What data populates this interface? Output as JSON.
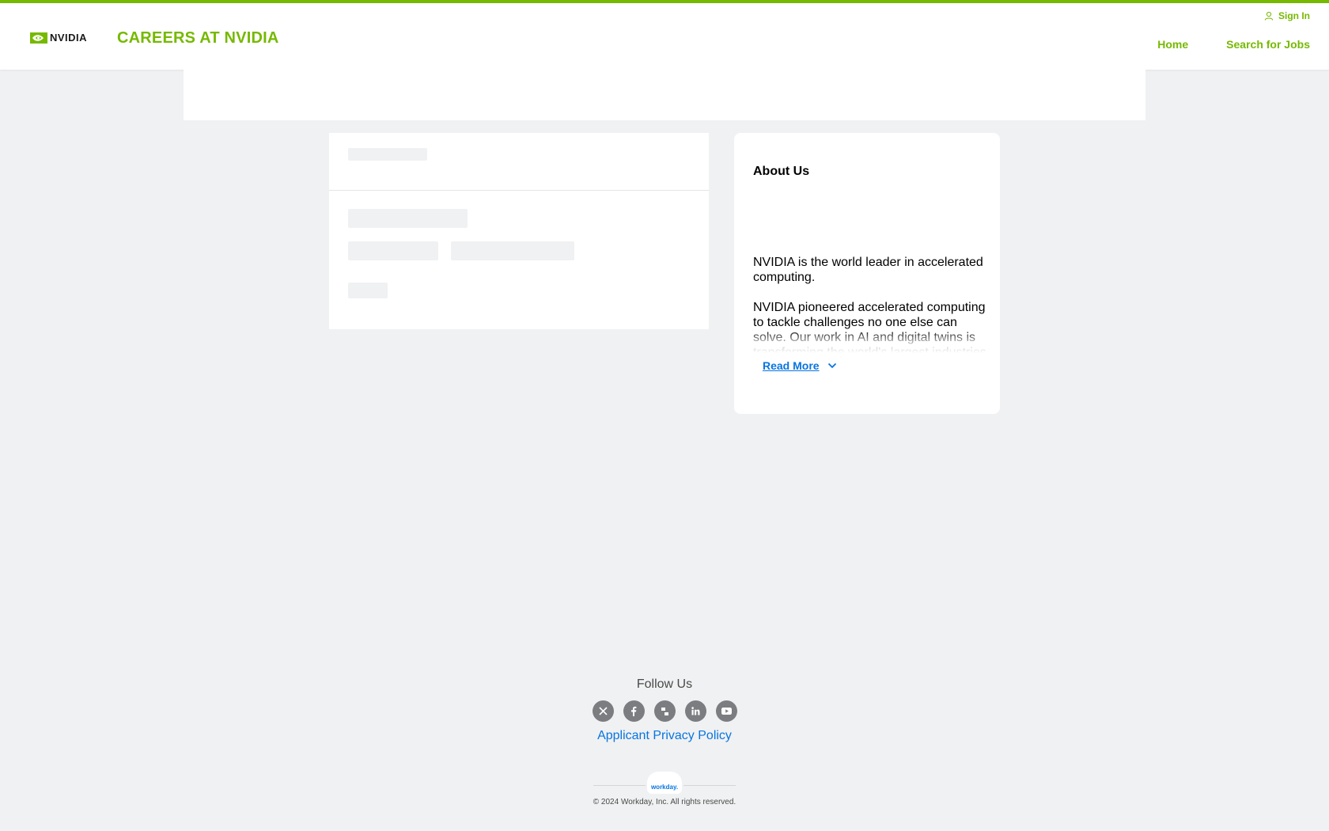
{
  "header": {
    "logo_text": "NVIDIA",
    "site_title": "CAREERS AT NVIDIA",
    "sign_in": "Sign In",
    "nav": [
      "Home",
      "Search for Jobs"
    ],
    "accent_color": "#76b900"
  },
  "about": {
    "title": "About Us",
    "paragraphs": [
      "NVIDIA is the world leader in accelerated computing.",
      "NVIDIA pioneered accelerated computing to tackle challenges no one else can solve. Our work in AI and digital twins is transforming the world's largest industries"
    ],
    "read_more": "Read More",
    "link_color": "#0875e1"
  },
  "footer": {
    "follow_title": "Follow Us",
    "socials": [
      "x-icon",
      "facebook-icon",
      "glassdoor-icon",
      "linkedin-icon",
      "youtube-icon"
    ],
    "privacy_link": "Applicant Privacy Policy",
    "workday_logo": "workday.",
    "copyright": "© 2024 Workday, Inc. All rights reserved."
  }
}
